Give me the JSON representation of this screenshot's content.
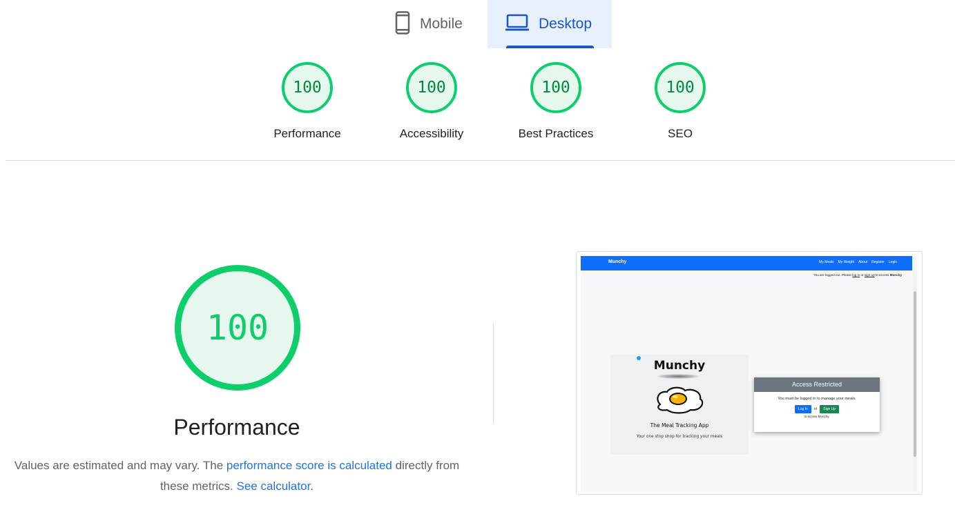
{
  "tabs": [
    {
      "label": "Mobile",
      "icon": "mobile-phone-icon",
      "selected": false
    },
    {
      "label": "Desktop",
      "icon": "laptop-icon",
      "selected": true
    }
  ],
  "gauges": [
    {
      "score": "100",
      "label": "Performance"
    },
    {
      "score": "100",
      "label": "Accessibility"
    },
    {
      "score": "100",
      "label": "Best Practices"
    },
    {
      "score": "100",
      "label": "SEO"
    }
  ],
  "colors": {
    "pass": "#0cce6b",
    "pass_bg": "#e6f7ee",
    "accent": "#1a56c6",
    "link": "#1a73e8"
  },
  "performance": {
    "score": "100",
    "title": "Performance",
    "desc_pre": "Values are estimated and may vary. The ",
    "desc_link1": "performance score is calculated",
    "desc_mid": " directly from these metrics. ",
    "desc_link2": "See calculator",
    "desc_post": "."
  },
  "screenshot": {
    "brand": "Munchy",
    "nav_links": [
      "My Meals",
      "My Weight",
      "About",
      "Register",
      "Login"
    ],
    "logout_pre": "You are logged out. Please ",
    "logout_login": "log in",
    "logout_or": " or ",
    "logout_signup": "sign up",
    "logout_post": " to access ",
    "logout_app": "Munchy",
    "hero_title": "Munchy",
    "hero_subtitle": "The Meal Tracking App",
    "hero_tagline": "Your one stop shop for tracking your meals",
    "card_title": "Access Restricted",
    "card_message": "You must be logged in to manage your meals.",
    "login_button": "Log In",
    "or_text": "or",
    "signup_button": "Sign Up",
    "access_text": "to access Munchy."
  }
}
